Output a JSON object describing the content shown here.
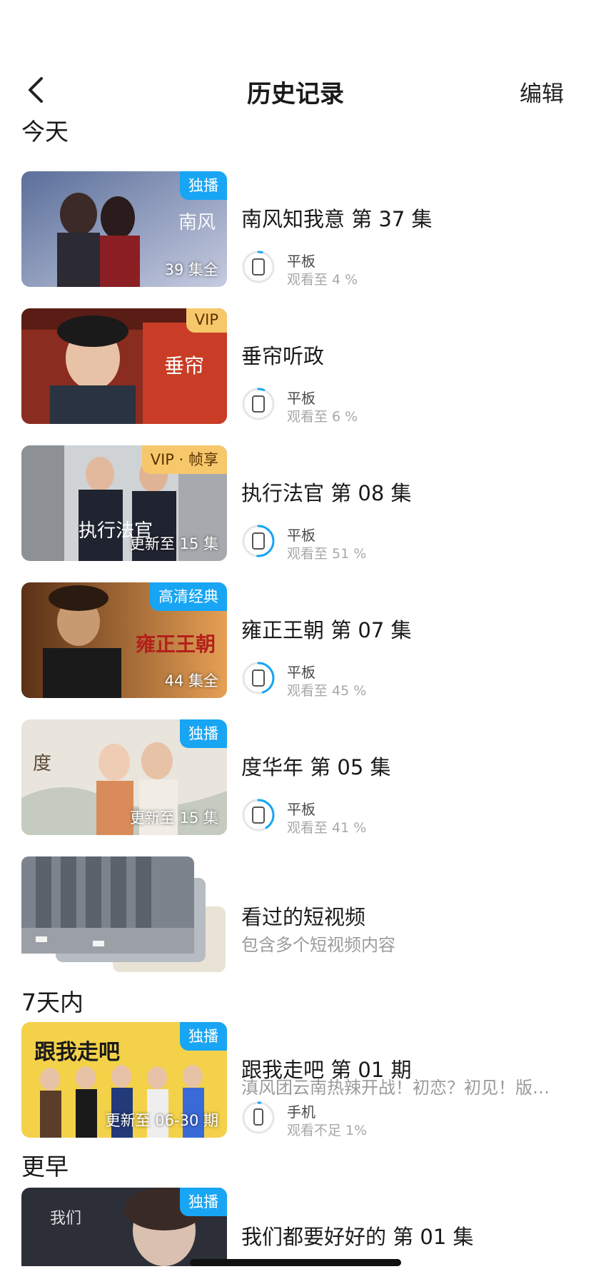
{
  "header": {
    "title": "历史记录",
    "edit_label": "编辑"
  },
  "sections": {
    "today": "今天",
    "week": "7天内",
    "earlier": "更早"
  },
  "items": [
    {
      "title": "南风知我意 第 37 集",
      "badge": "独播",
      "badge_color": "#18a5f4",
      "episodes": "39 集全",
      "device": "平板",
      "progress_text": "观看至 4 %",
      "progress": 0.04
    },
    {
      "title": "垂帘听政",
      "badge": "VIP",
      "badge_color": "#f7c86b",
      "episodes": "",
      "device": "平板",
      "progress_text": "观看至 6 %",
      "progress": 0.06
    },
    {
      "title": "执行法官 第 08 集",
      "badge": "VIP · 帧享",
      "badge_color": "#f7c86b",
      "episodes": "更新至 15 集",
      "device": "平板",
      "progress_text": "观看至 51 %",
      "progress": 0.51
    },
    {
      "title": "雍正王朝 第 07 集",
      "badge": "高清经典",
      "badge_color": "#18a5f4",
      "episodes": "44 集全",
      "device": "平板",
      "progress_text": "观看至 45 %",
      "progress": 0.45
    },
    {
      "title": "度华年 第 05 集",
      "badge": "独播",
      "badge_color": "#18a5f4",
      "episodes": "更新至 15 集",
      "device": "平板",
      "progress_text": "观看至 41 %",
      "progress": 0.41
    },
    {
      "title": "看过的短视频",
      "subtitle": "包含多个短视频内容"
    },
    {
      "title": "跟我走吧 第 01 期",
      "subtitle": "滇风团云南热辣开战！初恋？初见！版…",
      "badge": "独播",
      "badge_color": "#18a5f4",
      "episodes": "更新至 06-30 期",
      "device": "手机",
      "progress_text": "观看不足 1%",
      "progress": 0.01
    },
    {
      "title": "我们都要好好的 第 01 集",
      "badge": "独播",
      "badge_color": "#18a5f4"
    }
  ],
  "colors": {
    "accent": "#18a5f4",
    "vip_gold": "#f7c86b"
  },
  "icons": {
    "back": "chevron-left-icon",
    "device_tablet": "tablet-icon",
    "device_phone": "phone-icon"
  }
}
